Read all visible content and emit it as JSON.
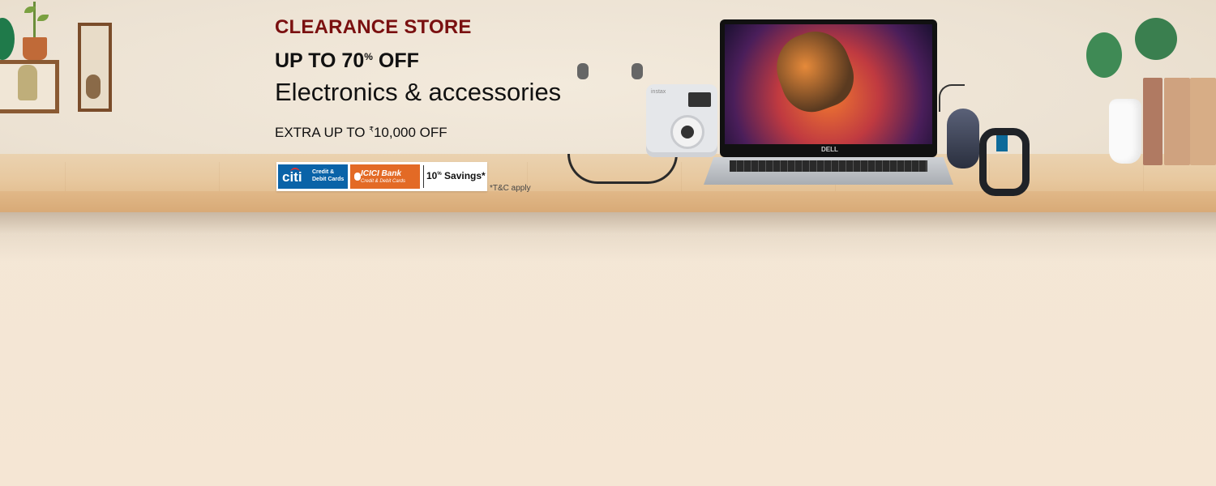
{
  "banner": {
    "title": "CLEARANCE STORE",
    "headline_prefix": "UP TO 70",
    "headline_sup": "%",
    "headline_suffix": " OFF",
    "subtitle": "Electronics & accessories",
    "extra_prefix": "EXTRA UP TO ",
    "extra_sup": "₹",
    "extra_amount": "10,000 OFF",
    "offers": {
      "citi_logo": "citi",
      "citi_cards": "Credit & Debit Cards",
      "icici_name": "ICICI Bank",
      "icici_cards": "Credit & Debit Cards",
      "savings_number": "10",
      "savings_sup": "%",
      "savings_text": " Savings*"
    },
    "tnc": "*T&C apply",
    "laptop_logo": "DELL",
    "camera_label": "instax",
    "colors": {
      "title": "#7a1010",
      "citi_bg": "#0a63a8",
      "icici_bg": "#e36a25",
      "background": "#f5e6d4"
    },
    "icons": [
      "headphones-icon",
      "camera-icon",
      "laptop-icon",
      "mouse-icon",
      "fitness-band-icon"
    ]
  }
}
